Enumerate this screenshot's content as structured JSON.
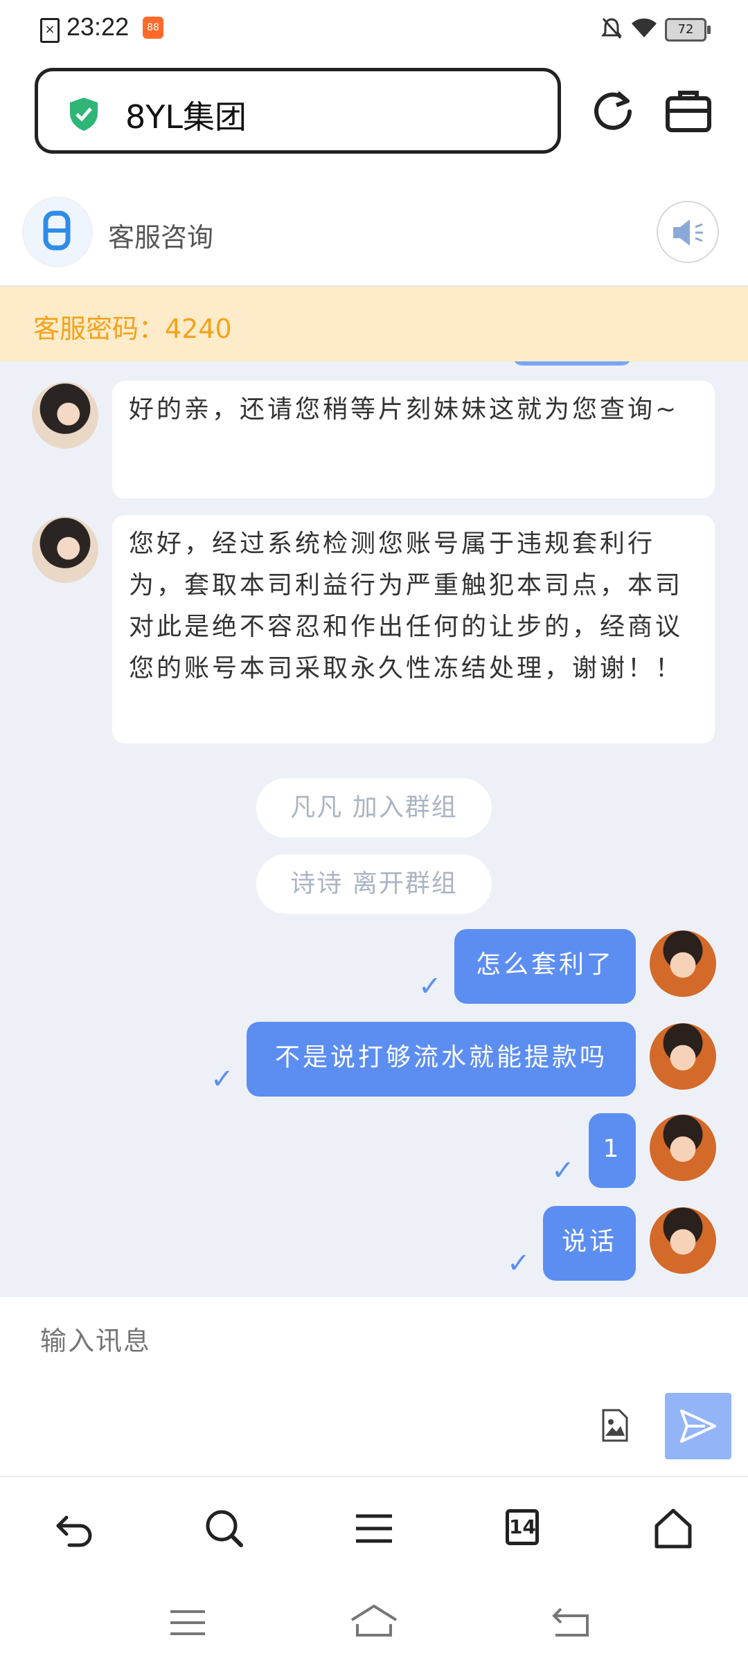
{
  "status": {
    "time": "23:22",
    "battery": "72",
    "app_badge": "88"
  },
  "url_bar": {
    "title": "8YL集团",
    "icon_color": "#2fb576"
  },
  "chat_header": {
    "title": "客服咨询"
  },
  "notice": {
    "text": "客服密码：4240"
  },
  "messages": [
    {
      "side": "left",
      "text": "好的亲，还请您稍等片刻妹妹这就为您查询~"
    },
    {
      "side": "left",
      "text": "您好，经过系统检测您账号属于违规套利行为，套取本司利益行为严重触犯本司点，本司对此是绝不容忍和作出任何的让步的，经商议您的账号本司采取永久性冻结处理，谢谢！！"
    },
    {
      "side": "system",
      "text": "凡凡 加入群组"
    },
    {
      "side": "system",
      "text": "诗诗 离开群组"
    },
    {
      "side": "right",
      "text": "怎么套利了"
    },
    {
      "side": "right",
      "text": "不是说打够流水就能提款吗"
    },
    {
      "side": "right",
      "text": "1"
    },
    {
      "side": "right",
      "text": "说话"
    }
  ],
  "input": {
    "placeholder": "输入讯息"
  },
  "navbar": {
    "tab_count": "14"
  },
  "colors": {
    "accent": "#5c8ef2",
    "notice_bg": "#fdebc9",
    "notice_text": "#f2a31b",
    "chat_bg": "#edf1f7"
  },
  "icons": [
    "sim-icon",
    "app-badge-icon",
    "mute-icon",
    "wifi-icon",
    "battery-icon",
    "shield-icon",
    "refresh-icon",
    "toolbox-icon",
    "speaker-icon",
    "image-file-icon",
    "send-icon",
    "back-icon",
    "search-icon",
    "menu-icon",
    "home-icon"
  ]
}
